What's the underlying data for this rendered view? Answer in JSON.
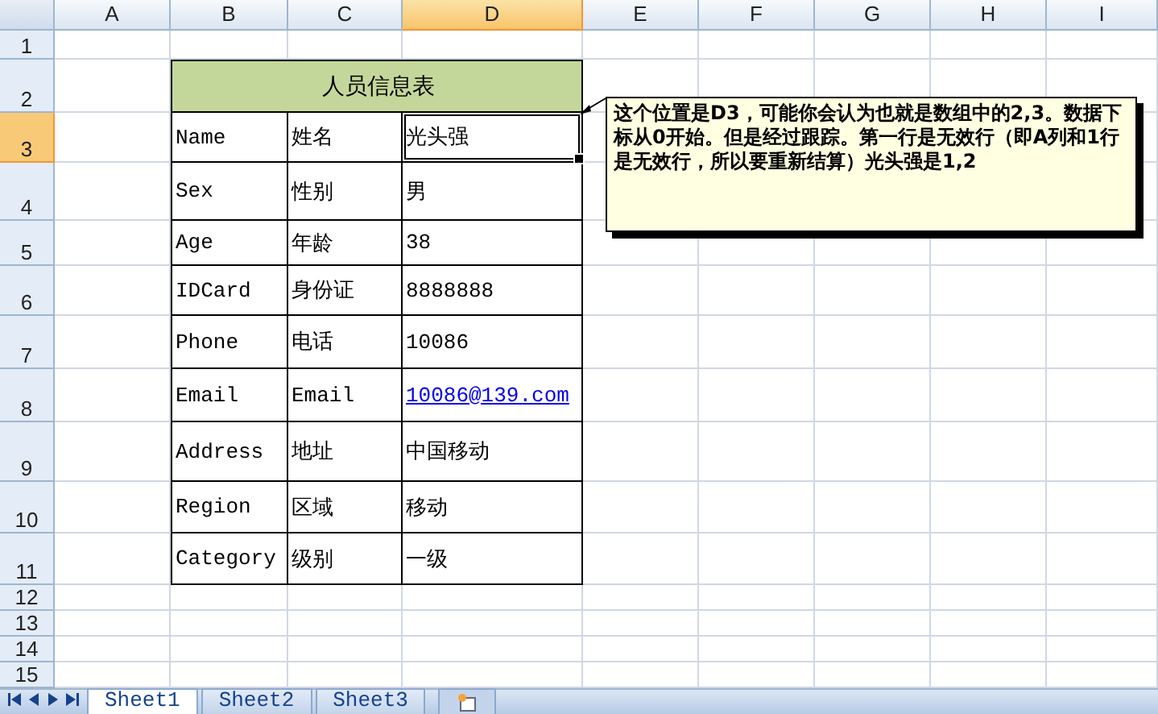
{
  "columns": [
    {
      "label": "A",
      "selected": false
    },
    {
      "label": "B",
      "selected": false
    },
    {
      "label": "C",
      "selected": false
    },
    {
      "label": "D",
      "selected": true
    },
    {
      "label": "E",
      "selected": false
    },
    {
      "label": "F",
      "selected": false
    },
    {
      "label": "G",
      "selected": false
    },
    {
      "label": "H",
      "selected": false
    },
    {
      "label": "I",
      "selected": false
    }
  ],
  "rows": [
    {
      "label": "1",
      "selected": false
    },
    {
      "label": "2",
      "selected": false
    },
    {
      "label": "3",
      "selected": true
    },
    {
      "label": "4",
      "selected": false
    },
    {
      "label": "5",
      "selected": false
    },
    {
      "label": "6",
      "selected": false
    },
    {
      "label": "7",
      "selected": false
    },
    {
      "label": "8",
      "selected": false
    },
    {
      "label": "9",
      "selected": false
    },
    {
      "label": "10",
      "selected": false
    },
    {
      "label": "11",
      "selected": false
    },
    {
      "label": "12",
      "selected": false
    },
    {
      "label": "13",
      "selected": false
    },
    {
      "label": "14",
      "selected": false
    },
    {
      "label": "15",
      "selected": false
    }
  ],
  "table": {
    "title": "人员信息表",
    "rows": [
      {
        "field": "Name",
        "label": "姓名",
        "value": "光头强",
        "kind": "text",
        "selected": true
      },
      {
        "field": "Sex",
        "label": "性别",
        "value": "男",
        "kind": "text",
        "selected": false
      },
      {
        "field": "Age",
        "label": "年龄",
        "value": "38",
        "kind": "text",
        "selected": false
      },
      {
        "field": "IDCard",
        "label": "身份证",
        "value": "8888888",
        "kind": "text",
        "selected": false
      },
      {
        "field": "Phone",
        "label": "电话",
        "value": "10086",
        "kind": "text",
        "selected": false
      },
      {
        "field": "Email",
        "label": "Email",
        "value": "10086@139.com",
        "kind": "link",
        "selected": false
      },
      {
        "field": "Address",
        "label": "地址",
        "value": "中国移动",
        "kind": "text",
        "selected": false
      },
      {
        "field": "Region",
        "label": "区域",
        "value": "移动",
        "kind": "text",
        "selected": false
      },
      {
        "field": "Category",
        "label": "级别",
        "value": "一级",
        "kind": "text",
        "selected": false
      }
    ]
  },
  "comment": {
    "text": "这个位置是D3，可能你会认为也就是数组中的2,3。数据下标从0开始。但是经过跟踪。第一行是无效行（即A列和1行是无效行，所以要重新结算）光头强是1,2"
  },
  "sheet_tabs": [
    {
      "label": "Sheet1",
      "selected": true
    },
    {
      "label": "Sheet2",
      "selected": false
    },
    {
      "label": "Sheet3",
      "selected": false
    }
  ]
}
